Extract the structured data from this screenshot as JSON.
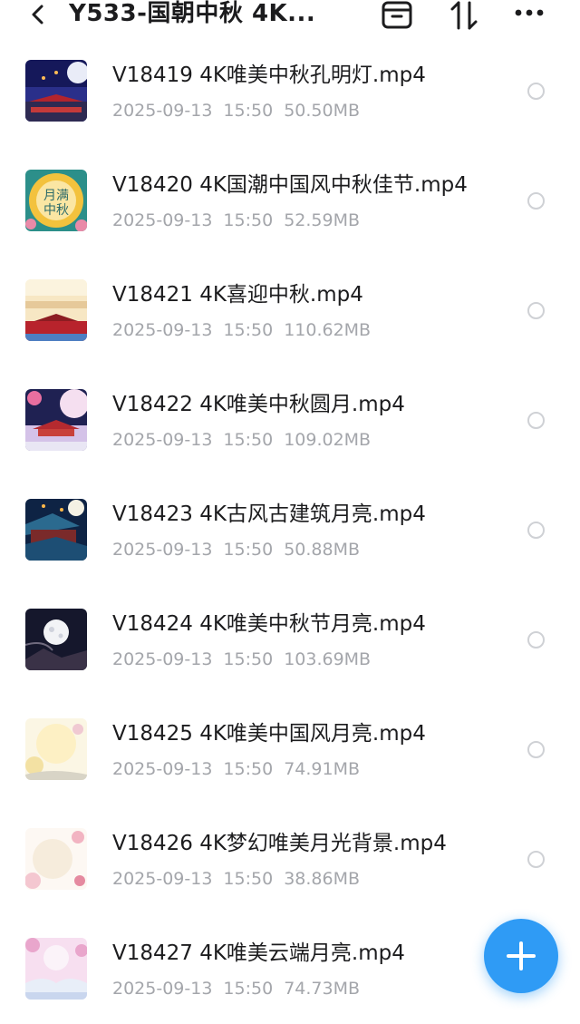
{
  "header": {
    "title": "Y533-国朝中秋 4K...",
    "icons": [
      "back-icon",
      "archive-icon",
      "sort-icon",
      "more-icon"
    ]
  },
  "files": [
    {
      "name": "V18419 4K唯美中秋孔明灯.mp4",
      "date": "2025-09-13",
      "time": "15:50",
      "size": "50.50MB",
      "thumb": "night-palace-moon"
    },
    {
      "name": "V18420 4K国潮中国风中秋佳节.mp4",
      "date": "2025-09-13",
      "time": "15:50",
      "size": "52.59MB",
      "thumb": "flower-badge"
    },
    {
      "name": "V18421 4K喜迎中秋.mp4",
      "date": "2025-09-13",
      "time": "15:50",
      "size": "110.62MB",
      "thumb": "red-gate-banner"
    },
    {
      "name": "V18422 4K唯美中秋圆月.mp4",
      "date": "2025-09-13",
      "time": "15:50",
      "size": "109.02MB",
      "thumb": "blossom-palace"
    },
    {
      "name": "V18423 4K古风古建筑月亮.mp4",
      "date": "2025-09-13",
      "time": "15:50",
      "size": "50.88MB",
      "thumb": "ancient-building"
    },
    {
      "name": "V18424 4K唯美中秋节月亮.mp4",
      "date": "2025-09-13",
      "time": "15:50",
      "size": "103.69MB",
      "thumb": "full-moon-night"
    },
    {
      "name": "V18425 4K唯美中国风月亮.mp4",
      "date": "2025-09-13",
      "time": "15:50",
      "size": "74.91MB",
      "thumb": "pale-moon-floral"
    },
    {
      "name": "V18426 4K梦幻唯美月光背景.mp4",
      "date": "2025-09-13",
      "time": "15:50",
      "size": "38.86MB",
      "thumb": "dreamy-moonlight"
    },
    {
      "name": "V18427 4K唯美云端月亮.mp4",
      "date": "2025-09-13",
      "time": "15:50",
      "size": "74.73MB",
      "thumb": "cloud-moon-pink"
    }
  ],
  "fab": {
    "icon": "plus-icon"
  },
  "colors": {
    "accent": "#2f9bf5",
    "meta_text": "#a4a6ab",
    "radio_border": "#cfd1d5"
  }
}
